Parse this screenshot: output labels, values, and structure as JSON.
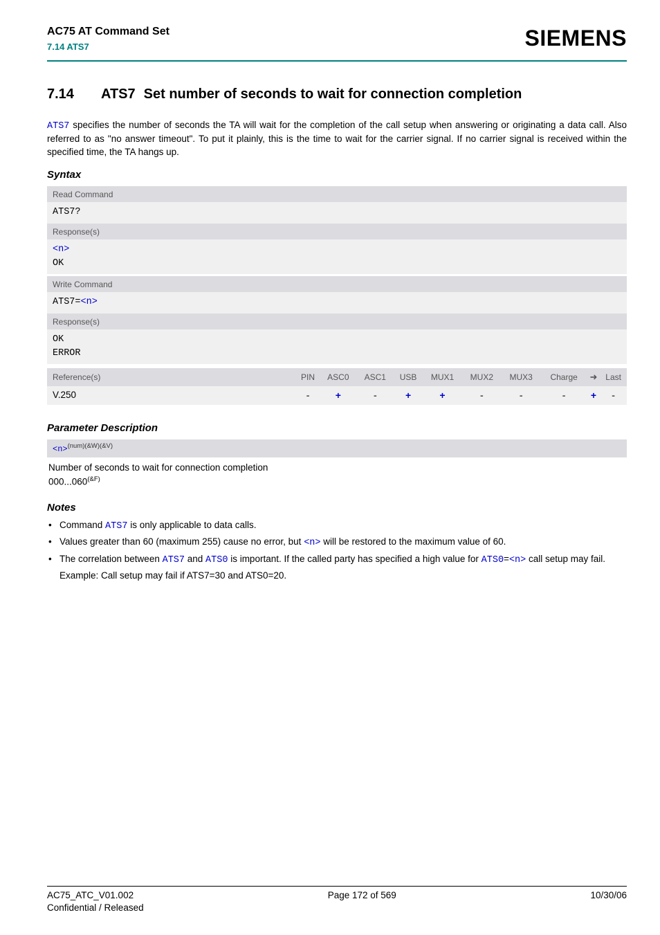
{
  "header": {
    "doc_title": "AC75 AT Command Set",
    "doc_sub": "7.14 ATS7",
    "brand": "SIEMENS"
  },
  "section": {
    "number": "7.14",
    "command": "ATS7",
    "title_rest": "Set number of seconds to wait for connection completion"
  },
  "intro": {
    "cmd": "ATS7",
    "text_after": " specifies the number of seconds the TA will wait for the completion of the call setup when answering or originating a data call. Also referred to as \"no answer timeout\". To put it plainly, this is the time to wait for the carrier signal. If no carrier signal is received within the specified time, the TA hangs up."
  },
  "syntax_heading": "Syntax",
  "syntax": {
    "read_label": "Read Command",
    "read_cmd": "ATS7?",
    "read_resp_label": "Response(s)",
    "read_resp_n": "<n>",
    "read_resp_ok": "OK",
    "write_label": "Write Command",
    "write_cmd_prefix": "ATS7=",
    "write_cmd_param": "<n>",
    "write_resp_label": "Response(s)",
    "write_resp_ok": "OK",
    "write_resp_err": "ERROR"
  },
  "ref": {
    "ref_label": "Reference(s)",
    "headers": [
      "PIN",
      "ASC0",
      "ASC1",
      "USB",
      "MUX1",
      "MUX2",
      "MUX3",
      "Charge",
      "➜",
      "Last"
    ],
    "ref_value": "V.250",
    "values": [
      "-",
      "+",
      "-",
      "+",
      "+",
      "-",
      "-",
      "-",
      "+",
      "-"
    ]
  },
  "param_heading": "Parameter Description",
  "param": {
    "name": "<n>",
    "sup": "(num)(&W)(&V)",
    "desc": "Number of seconds to wait for connection completion",
    "range": "000...060",
    "range_sup": "(&F)"
  },
  "notes_heading": "Notes",
  "notes": {
    "n1_a": "Command ",
    "n1_cmd": "ATS7",
    "n1_b": " is only applicable to data calls.",
    "n2_a": "Values greater than 60 (maximum 255) cause no error, but ",
    "n2_param": "<n>",
    "n2_b": " will be restored to the maximum value of 60.",
    "n3_a": "The correlation between ",
    "n3_cmd1": "ATS7",
    "n3_b": " and ",
    "n3_cmd2": "ATS0",
    "n3_c": " is important. If the called party has specified a high value for ",
    "n3_cmd3": "ATS0",
    "n3_d": "=",
    "n3_param": "<n>",
    "n3_e": " call setup may fail.",
    "n3_example": "Example: Call setup may fail if ATS7=30 and ATS0=20."
  },
  "footer": {
    "left": "AC75_ATC_V01.002",
    "center": "Page 172 of 569",
    "right": "10/30/06",
    "left2": "Confidential / Released"
  }
}
